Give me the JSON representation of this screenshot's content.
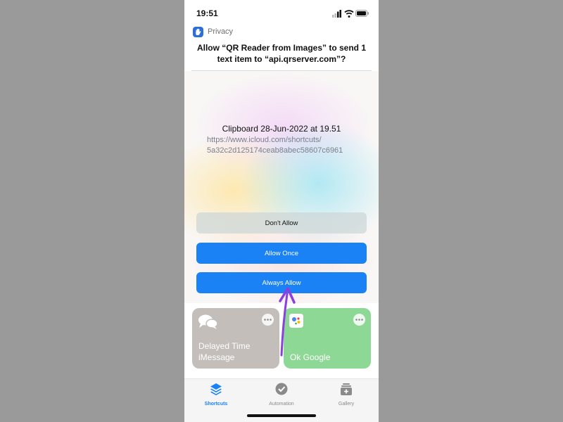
{
  "status_bar": {
    "time": "19:51"
  },
  "dialog": {
    "section_label": "Privacy",
    "title": "Allow “QR Reader from Images” to send 1 text item to “api.qrserver.com”?",
    "clipboard_title": "Clipboard 28-Jun-2022 at 19.51",
    "clipboard_url_line1": "https://www.icloud.com/shortcuts/",
    "clipboard_url_line2": "5a32c2d125174ceab8abec58607c6961",
    "buttons": {
      "deny": "Don't Allow",
      "once": "Allow Once",
      "always": "Always Allow"
    }
  },
  "shortcuts": [
    {
      "label_line1": "Delayed Time",
      "label_line2": "iMessage",
      "icon": "chat-bubbles-icon",
      "color": "#c4beba"
    },
    {
      "label_line1": "Ok Google",
      "label_line2": "",
      "icon": "google-assistant-icon",
      "color": "#8ed896"
    }
  ],
  "tabbar": {
    "shortcuts": "Shortcuts",
    "automation": "Automation",
    "gallery": "Gallery",
    "active_color": "#1a82f5",
    "inactive_color": "#8a8a8a"
  },
  "annotation": {
    "arrow_color": "#8a3fe0",
    "icon": "arrow-up-icon"
  }
}
